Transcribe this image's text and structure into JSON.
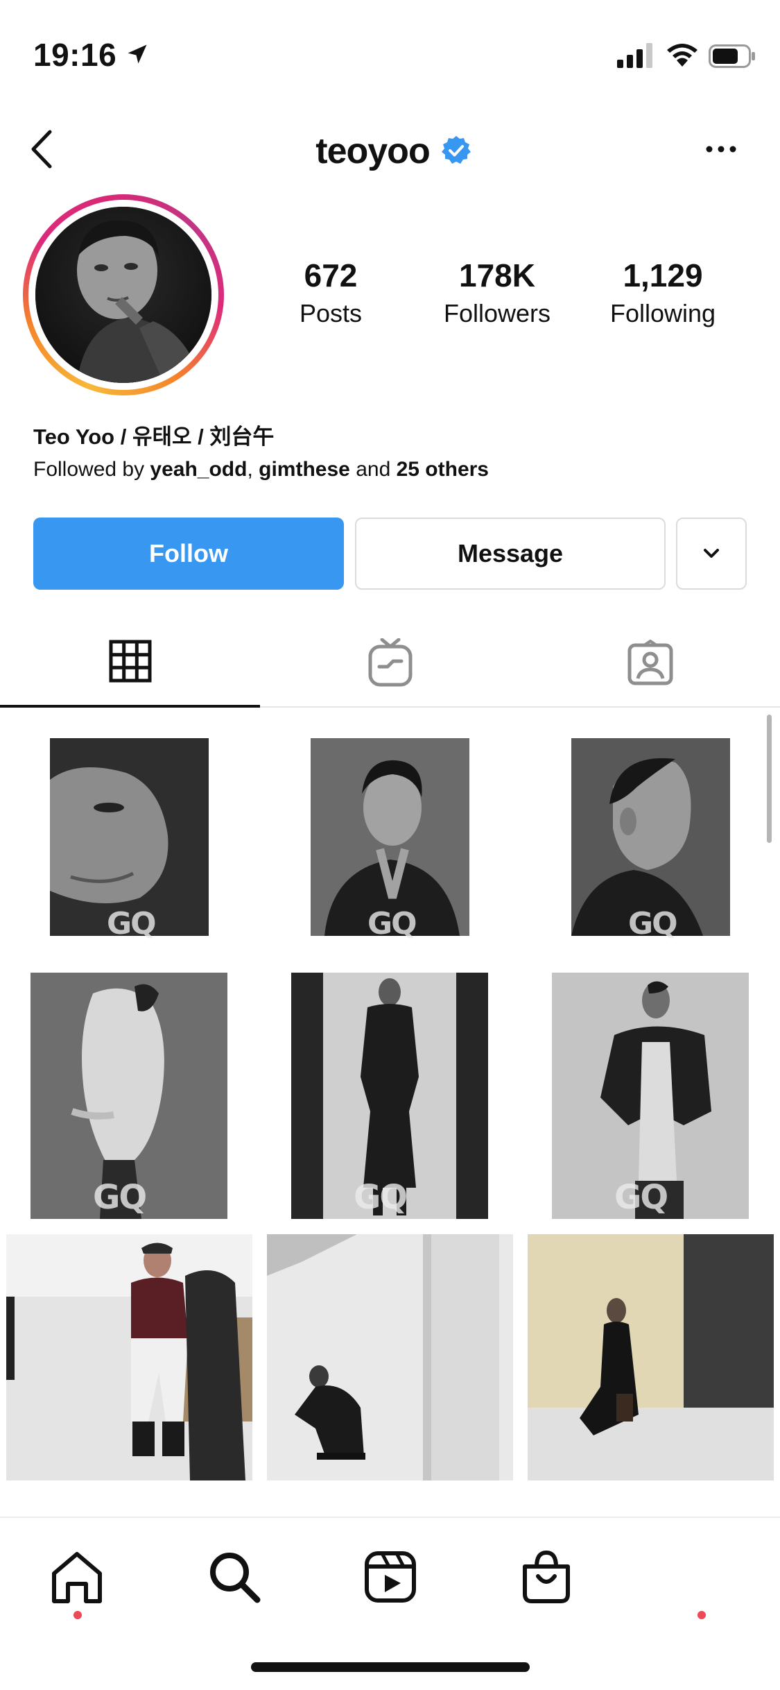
{
  "status_bar": {
    "time": "19:16",
    "icons": [
      "location-arrow-icon",
      "cellular-signal-icon",
      "wifi-icon",
      "battery-icon"
    ]
  },
  "header": {
    "username": "teoyoo",
    "verified": true,
    "icons": [
      "back-chevron-icon",
      "verified-badge-icon",
      "more-options-icon"
    ]
  },
  "profile": {
    "stats": [
      {
        "value": "672",
        "label": "Posts"
      },
      {
        "value": "178K",
        "label": "Followers"
      },
      {
        "value": "1,129",
        "label": "Following"
      }
    ],
    "full_name": "Teo Yoo / 유태오 / 刘台午",
    "followed_by": {
      "prefix": "Followed by ",
      "user1": "yeah_odd",
      "separator": ", ",
      "user2": "gimthese",
      "middle": " and ",
      "others": "25 others"
    }
  },
  "actions": {
    "follow_label": "Follow",
    "message_label": "Message"
  },
  "tabs": [
    {
      "name": "posts-grid",
      "icon": "grid-icon",
      "active": true
    },
    {
      "name": "igtv",
      "icon": "igtv-icon",
      "active": false
    },
    {
      "name": "tagged",
      "icon": "tagged-person-icon",
      "active": false
    }
  ],
  "grid": {
    "watermark_text": "GQ"
  },
  "bottom_nav": {
    "items": [
      "home-icon",
      "search-icon",
      "reels-icon",
      "shop-icon",
      "profile-icon"
    ]
  },
  "colors": {
    "follow_button": "#3897f0",
    "verified_badge": "#3897f0",
    "notification_dot": "#ed4956"
  }
}
